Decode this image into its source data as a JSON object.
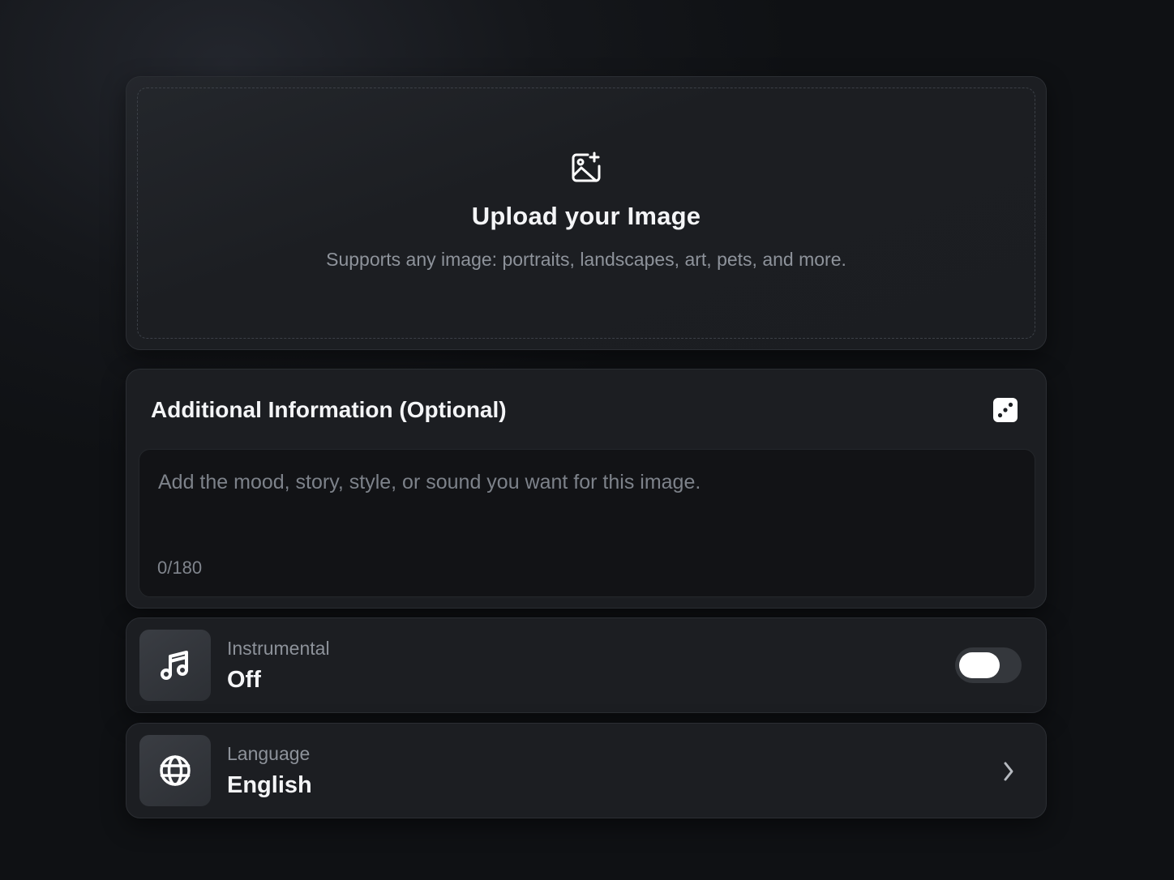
{
  "upload": {
    "icon": "image-plus-icon",
    "title": "Upload your Image",
    "subtitle": "Supports any image: portraits, landscapes, art, pets, and more."
  },
  "additional_info": {
    "title": "Additional Information (Optional)",
    "random_icon": "dice-icon",
    "placeholder": "Add the mood, story, style, or sound you want for this image.",
    "value": "",
    "char_count": "0/180"
  },
  "instrumental": {
    "icon": "music-note-icon",
    "label": "Instrumental",
    "value": "Off",
    "enabled": false
  },
  "language": {
    "icon": "globe-icon",
    "label": "Language",
    "value": "English",
    "chevron": "chevron-right-icon"
  }
}
